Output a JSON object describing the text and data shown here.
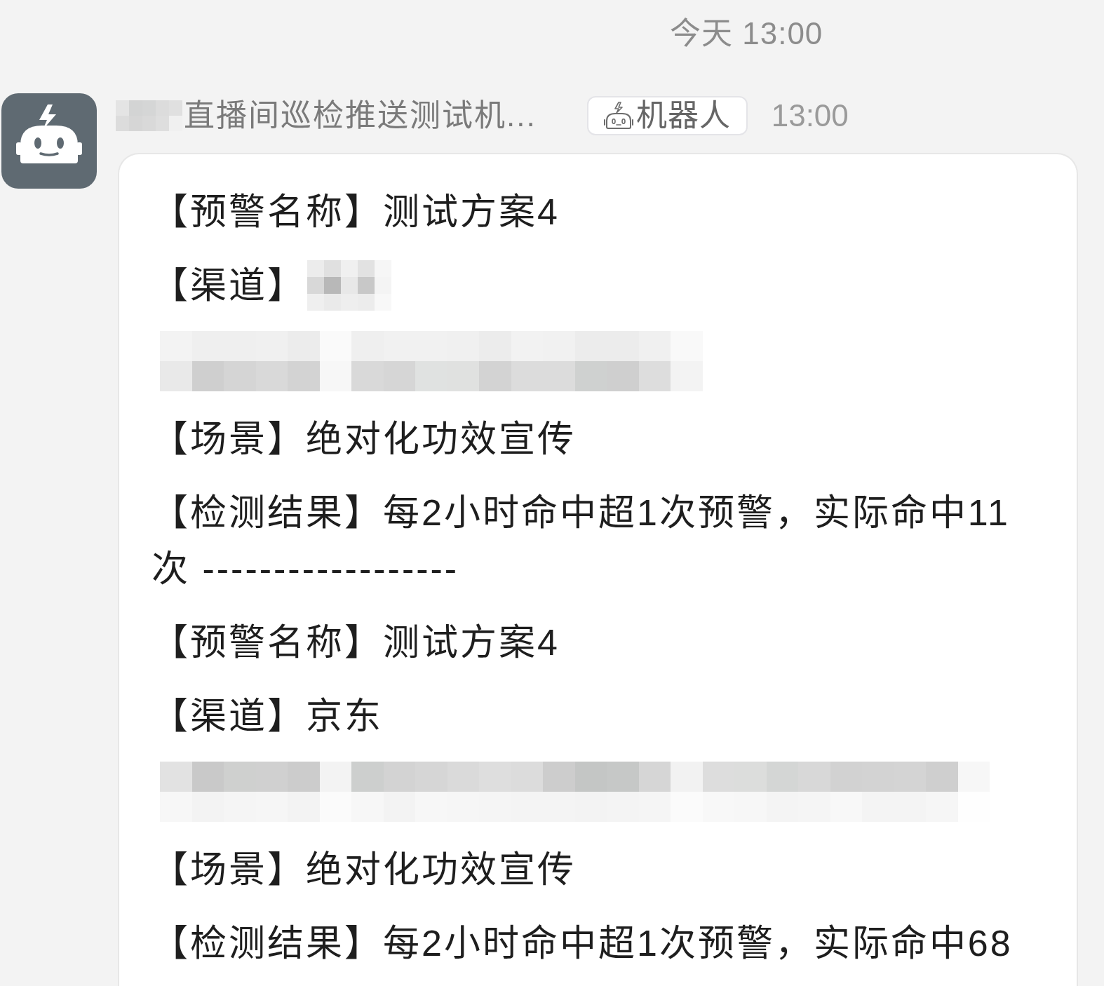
{
  "date_divider": {
    "text": "今天 13:00"
  },
  "message": {
    "sender": {
      "name": "直播间巡检推送测试机...",
      "name_redacted": true,
      "badge": "机器人",
      "time": "13:00"
    },
    "lines": [
      {
        "kind": "text",
        "text": "【预警名称】测试方案4"
      },
      {
        "kind": "label_redacted",
        "text": "【渠道】"
      },
      {
        "kind": "redacted"
      },
      {
        "kind": "text",
        "text": "【场景】绝对化功效宣传"
      },
      {
        "kind": "text",
        "text": "【检测结果】每2小时命中超1次预警，实际命中11次 ------------------"
      },
      {
        "kind": "text",
        "text": "【预警名称】测试方案4"
      },
      {
        "kind": "text",
        "text": "【渠道】京东"
      },
      {
        "kind": "redacted"
      },
      {
        "kind": "text",
        "text": "【场景】绝对化功效宣传"
      },
      {
        "kind": "text",
        "text": "【检测结果】每2小时命中超1次预警，实际命中68"
      }
    ]
  }
}
